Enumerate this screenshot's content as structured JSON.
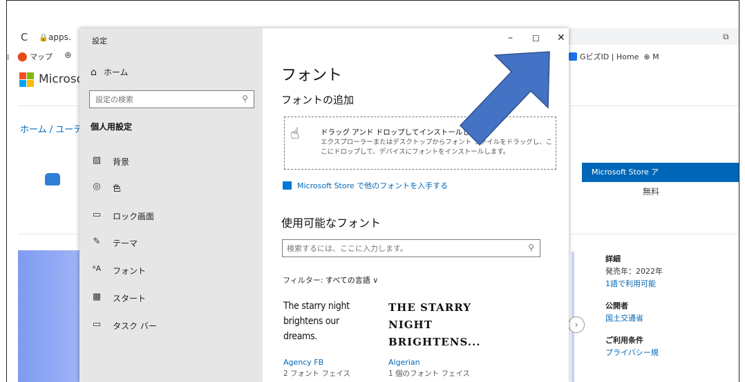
{
  "browser": {
    "url_text": "apps.",
    "bookmarks_left": {
      "map": "マップ"
    },
    "bookmarks_right": "GビズID | Home",
    "brand": "Microso",
    "breadcrumb": "ホーム / ユーティ",
    "store_button": "Microsoft Store ア",
    "price": "無料",
    "details": {
      "heading": "詳細",
      "release": "発売年：2022年",
      "language": "1語で利用可能",
      "publisher_heading": "公開者",
      "publisher": "国土交通省",
      "terms_heading": "ご利用条件",
      "privacy": "プライバシー規"
    }
  },
  "settings": {
    "window_title": "設定",
    "controls": {
      "minimize": "–",
      "maximize": "☐",
      "close": "✕"
    },
    "nav": {
      "home": "ホーム",
      "search_placeholder": "設定の検索",
      "section": "個人用設定",
      "items": [
        {
          "label": "背景",
          "icon": "background-icon"
        },
        {
          "label": "色",
          "icon": "palette-icon"
        },
        {
          "label": "ロック画面",
          "icon": "lock-screen-icon"
        },
        {
          "label": "テーマ",
          "icon": "theme-icon"
        },
        {
          "label": "フォント",
          "icon": "font-icon"
        },
        {
          "label": "スタート",
          "icon": "start-icon"
        },
        {
          "label": "タスク バー",
          "icon": "taskbar-icon"
        }
      ],
      "active": "フォント"
    },
    "content": {
      "title": "フォント",
      "add_heading": "フォントの追加",
      "drop_title": "ドラッグ アンド ドロップしてインストールします",
      "drop_desc": "エクスプローラーまたはデスクトップからフォント ファイルをドラッグし、ここにドロップして、デバイスにフォントをインストールします。",
      "store_link": "Microsoft Store で他のフォントを入手する",
      "available_heading": "使用可能なフォント",
      "font_search_placeholder": "検索するには、ここに入力します。",
      "filter_label": "フィルター: ",
      "filter_value": "すべての言語",
      "fonts": [
        {
          "preview": "The starry night brightens our dreams.",
          "name": "Agency FB",
          "count": "2 フォント フェイス"
        },
        {
          "preview": "THE STARRY NIGHT BRIGHTENS...",
          "name": "Algerian",
          "count": "1 個のフォント フェイス"
        }
      ]
    }
  },
  "colors": {
    "accent": "#0078d7",
    "link": "#0067b8",
    "nav_bg": "#e6e6e6",
    "annotation_arrow": "#4472c4"
  }
}
